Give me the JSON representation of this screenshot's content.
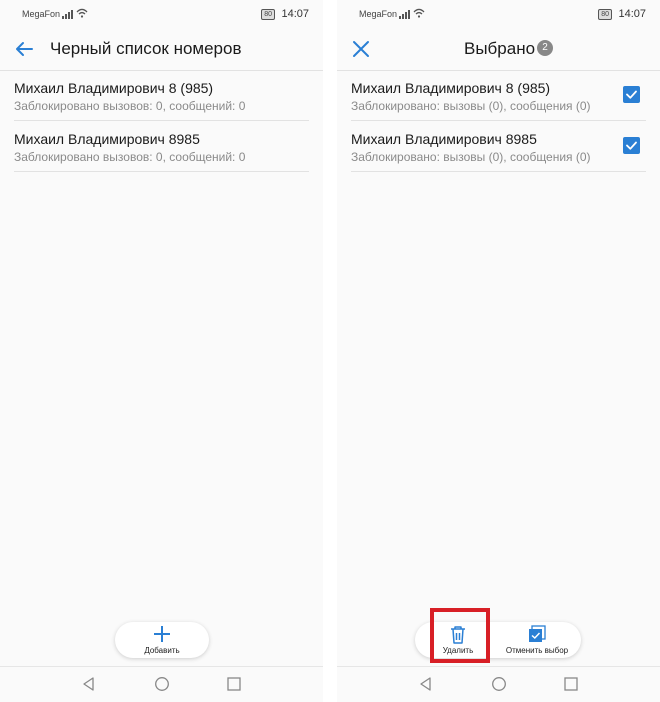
{
  "status_bar": {
    "carrier": "MegaFon",
    "battery": "80",
    "time": "14:07"
  },
  "left_screen": {
    "title": "Черный список номеров",
    "contacts": [
      {
        "name": "Михаил Владимирович 8 (985)",
        "detail": "Заблокировано вызовов: 0, сообщений: 0"
      },
      {
        "name": "Михаил Владимирович 8985",
        "detail": "Заблокировано вызовов: 0, сообщений: 0"
      }
    ],
    "add_label": "Добавить"
  },
  "right_screen": {
    "title": "Выбрано",
    "selected_count": "2",
    "contacts": [
      {
        "name": "Михаил Владимирович 8 (985)",
        "detail": "Заблокировано: вызовы (0), сообщения (0)",
        "checked": true
      },
      {
        "name": "Михаил Владимирович 8985",
        "detail": "Заблокировано: вызовы (0), сообщения (0)",
        "checked": true
      }
    ],
    "delete_label": "Удалить",
    "deselect_label": "Отменить выбор"
  },
  "colors": {
    "accent": "#2a7fd4",
    "highlight": "#d81f26"
  },
  "icons": [
    "back-arrow-icon",
    "close-icon",
    "plus-icon",
    "trash-icon",
    "deselect-icon",
    "nav-back-icon",
    "nav-home-icon",
    "nav-recents-icon",
    "signal-icon",
    "wifi-icon",
    "checkbox-checked-icon"
  ]
}
